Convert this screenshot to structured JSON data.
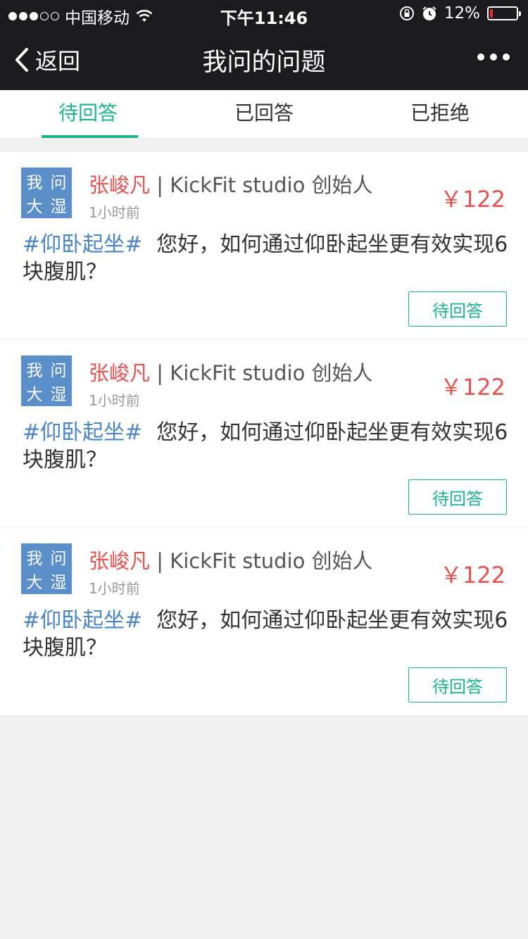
{
  "status_bar": {
    "carrier": "中国移动",
    "time": "下午11:46",
    "battery_percent": "12%",
    "battery_level": 0.12,
    "signal_bars_filled": 3,
    "signal_bars_total": 5,
    "battery_color": "#e3302f"
  },
  "nav": {
    "back_label": "返回",
    "title": "我问的问题"
  },
  "tabs": [
    {
      "label": "待回答",
      "active": true
    },
    {
      "label": "已回答",
      "active": false
    },
    {
      "label": "已拒绝",
      "active": false
    }
  ],
  "colors": {
    "accent": "#1db491",
    "price": "#e55353",
    "topic": "#4a85c7",
    "avatar_bg": "#5b8fc9"
  },
  "questions": [
    {
      "avatar_chars": [
        "我",
        "问",
        "大",
        "湿"
      ],
      "name": "张峻凡",
      "title": "| KickFit studio 创始人",
      "time_ago": "1小时前",
      "price": "￥122",
      "topic": "#仰卧起坐#",
      "text": "您好，如何通过仰卧起坐更有效实现6块腹肌？",
      "status": "待回答"
    },
    {
      "avatar_chars": [
        "我",
        "问",
        "大",
        "湿"
      ],
      "name": "张峻凡",
      "title": "| KickFit studio 创始人",
      "time_ago": "1小时前",
      "price": "￥122",
      "topic": "#仰卧起坐#",
      "text": "您好，如何通过仰卧起坐更有效实现6块腹肌？",
      "status": "待回答"
    },
    {
      "avatar_chars": [
        "我",
        "问",
        "大",
        "湿"
      ],
      "name": "张峻凡",
      "title": "| KickFit studio 创始人",
      "time_ago": "1小时前",
      "price": "￥122",
      "topic": "#仰卧起坐#",
      "text": "您好，如何通过仰卧起坐更有效实现6块腹肌？",
      "status": "待回答"
    }
  ]
}
